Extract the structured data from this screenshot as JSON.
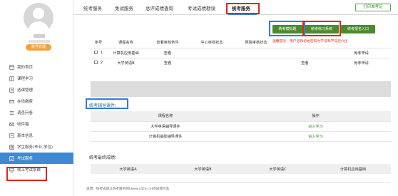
{
  "sidebar": {
    "account_button": "账号管理",
    "items": [
      {
        "label": "我的首页",
        "icon": "home-icon"
      },
      {
        "label": "课程学习",
        "icon": "book-icon"
      },
      {
        "label": "选课管理",
        "icon": "list-icon"
      },
      {
        "label": "在线缴费",
        "icon": "card-icon"
      },
      {
        "label": "调查问卷",
        "icon": "survey-icon"
      },
      {
        "label": "收件箱",
        "icon": "inbox-icon"
      },
      {
        "label": "基本信息",
        "icon": "info-icon"
      },
      {
        "label": "学生服务(毕业,学位)",
        "icon": "service-icon"
      },
      {
        "label": "考试服务",
        "icon": "exam-icon",
        "active": true
      },
      {
        "label": "线上考试系统",
        "icon": "online-exam-icon"
      }
    ]
  },
  "tabs": [
    {
      "label": "统考服务"
    },
    {
      "label": "免试服务"
    },
    {
      "label": "总评成绩查询"
    },
    {
      "label": "考试成绩勘误"
    },
    {
      "label": "统考服务",
      "active": true
    }
  ],
  "print_button": "打印准考证",
  "sub_buttons": {
    "mock_exam": "统考模拟题",
    "practice": "统考练习系统",
    "signup": "统考报名入口"
  },
  "tip": "温馨提示：用户名和初始密码为学号和学号后六位",
  "exam_table": {
    "headers": [
      "序号",
      "课程名称",
      "查看审核条件",
      "中心审核状态",
      "网院审核状态",
      "",
      ""
    ],
    "rows": [
      {
        "index": "1",
        "course": "计算机应用基础",
        "view": "查看",
        "center": "",
        "net": "",
        "col6": "",
        "apply": "免考申请"
      },
      {
        "index": "2",
        "course": "大学英语B",
        "view": "查看",
        "center": "",
        "net": "",
        "col6": "查看",
        "apply": "免考申请"
      }
    ]
  },
  "tutorial": {
    "title": "统考辅导课件：",
    "headers": [
      "课程名称",
      "操作"
    ],
    "rows": [
      {
        "course": "大学英语辅导课件",
        "action": "进入学习"
      },
      {
        "course": "计算机基础辅导课件",
        "action": "进入学习"
      }
    ]
  },
  "scores": {
    "title": "统考最终成绩：",
    "headers": [
      "大学英语A",
      "大学英语B",
      "大学英语C",
      "计算机应用基础"
    ]
  },
  "note": "说明：统考成绩以统考服务网(www.cdce.cn)的成绩为准",
  "colors": {
    "accent_blue": "#3f89d3",
    "highlight_red": "#e02424",
    "highlight_blue": "#2f7de1",
    "button_green": "#4b8b2e",
    "account_orange": "#f0a23b"
  }
}
